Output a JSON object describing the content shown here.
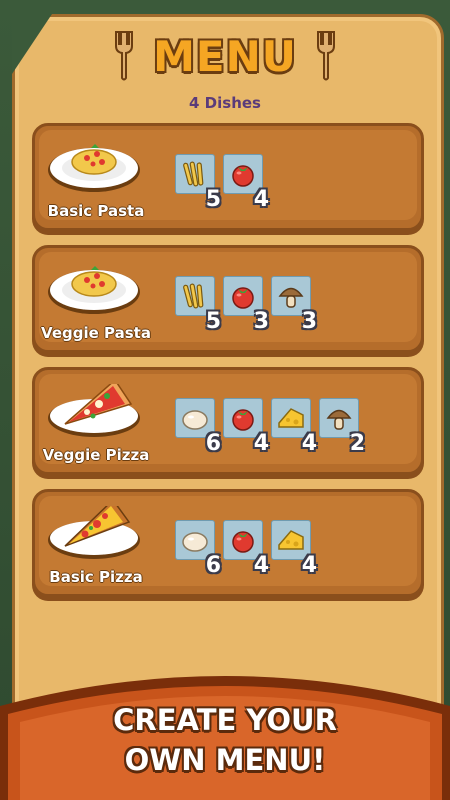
{
  "header": {
    "title": "MENU",
    "dish_count": "4 Dishes"
  },
  "dishes": [
    {
      "name": "Basic Pasta",
      "plate": "pasta",
      "ingredients": [
        {
          "icon": "pasta-icon",
          "count": "5"
        },
        {
          "icon": "tomato-icon",
          "count": "4"
        }
      ]
    },
    {
      "name": "Veggie Pasta",
      "plate": "pasta",
      "ingredients": [
        {
          "icon": "pasta-icon",
          "count": "5"
        },
        {
          "icon": "tomato-icon",
          "count": "3"
        },
        {
          "icon": "mushroom-icon",
          "count": "3"
        }
      ]
    },
    {
      "name": "Veggie Pizza",
      "plate": "veggie-pizza",
      "ingredients": [
        {
          "icon": "dough-icon",
          "count": "6"
        },
        {
          "icon": "tomato-icon",
          "count": "4"
        },
        {
          "icon": "cheese-icon",
          "count": "4"
        },
        {
          "icon": "mushroom-icon",
          "count": "2"
        }
      ]
    },
    {
      "name": "Basic Pizza",
      "plate": "pizza",
      "ingredients": [
        {
          "icon": "dough-icon",
          "count": "6"
        },
        {
          "icon": "tomato-icon",
          "count": "4"
        },
        {
          "icon": "cheese-icon",
          "count": "4"
        }
      ]
    }
  ],
  "banner": {
    "line1": "CREATE YOUR",
    "line2": "OWN MENU!"
  },
  "colors": {
    "title": "#f5a623",
    "card": "#c47a33",
    "banner": "#c8541b"
  }
}
